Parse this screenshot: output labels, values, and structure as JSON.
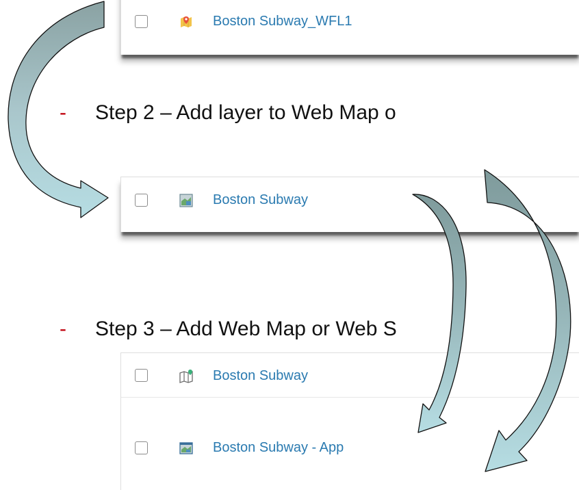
{
  "panel1": {
    "items": [
      {
        "label": "Boston Subway_WFL1",
        "icon": "feature-layer-icon"
      }
    ]
  },
  "step2": {
    "dash": "-",
    "text": "Step 2 – Add layer to Web Map o"
  },
  "panel2": {
    "items": [
      {
        "label": "Boston Subway",
        "icon": "map-service-icon"
      }
    ]
  },
  "step3": {
    "dash": "-",
    "text": "Step 3 – Add Web Map or Web S"
  },
  "panel3": {
    "items": [
      {
        "label": "Boston Subway",
        "icon": "web-map-icon"
      },
      {
        "label": "Boston Subway - App",
        "icon": "web-app-icon"
      }
    ]
  },
  "colors": {
    "link": "#2a7ab0",
    "step_dash": "#c0000c",
    "arrow_light": "#b6dde3",
    "arrow_dark": "#8aa2a3"
  }
}
